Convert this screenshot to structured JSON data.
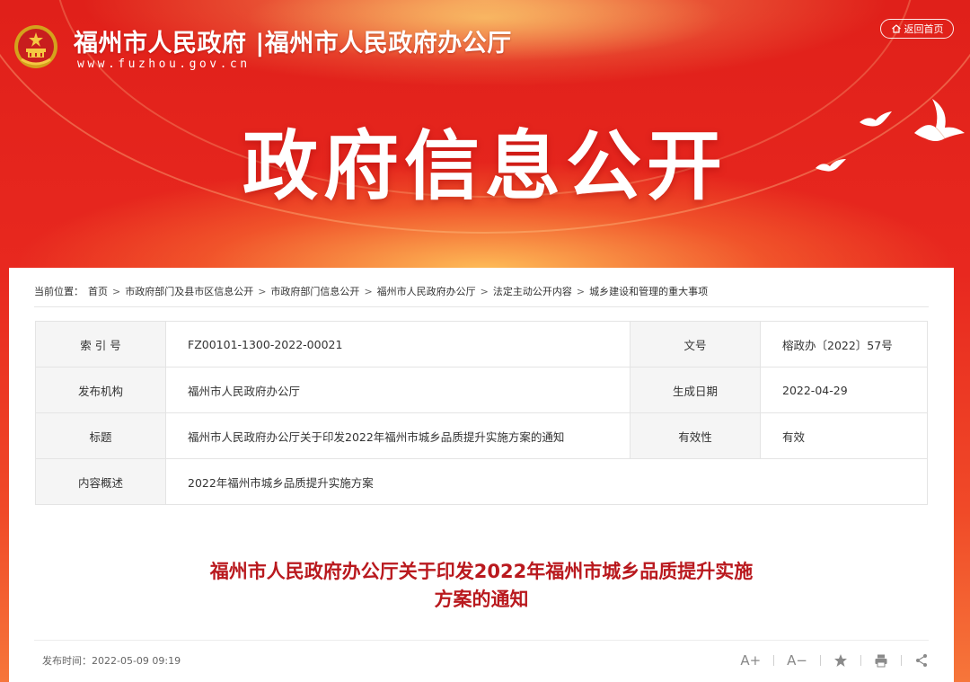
{
  "header": {
    "site_title": "福州市人民政府 |福州市人民政府办公厅",
    "site_url": "www.fuzhou.gov.cn",
    "home_label": "返回首页",
    "hero_title": "政府信息公开"
  },
  "breadcrumb": {
    "label": "当前位置：",
    "items": [
      "首页",
      "市政府部门及县市区信息公开",
      "市政府部门信息公开",
      "福州市人民政府办公厅",
      "法定主动公开内容",
      "城乡建设和管理的重大事项"
    ]
  },
  "meta": {
    "index_label": "索 引 号",
    "index_value": "FZ00101-1300-2022-00021",
    "docno_label": "文号",
    "docno_value": "榕政办〔2022〕57号",
    "org_label": "发布机构",
    "org_value": "福州市人民政府办公厅",
    "date_label": "生成日期",
    "date_value": "2022-04-29",
    "title_label": "标题",
    "title_value": "福州市人民政府办公厅关于印发2022年福州市城乡品质提升实施方案的通知",
    "valid_label": "有效性",
    "valid_value": "有效",
    "summary_label": "内容概述",
    "summary_value": "2022年福州市城乡品质提升实施方案"
  },
  "article": {
    "title_line1": "福州市人民政府办公厅关于印发2022年福州市城乡品质提升实施",
    "title_line2": "方案的通知",
    "publish_time": "发布时间：2022-05-09 09:19"
  },
  "tools": {
    "font_increase": "A+",
    "font_decrease": "A−",
    "icons": [
      "star-icon",
      "print-icon",
      "share-icon"
    ]
  },
  "colors": {
    "banner_red": "#e8281f",
    "title_red": "#b9191e"
  }
}
